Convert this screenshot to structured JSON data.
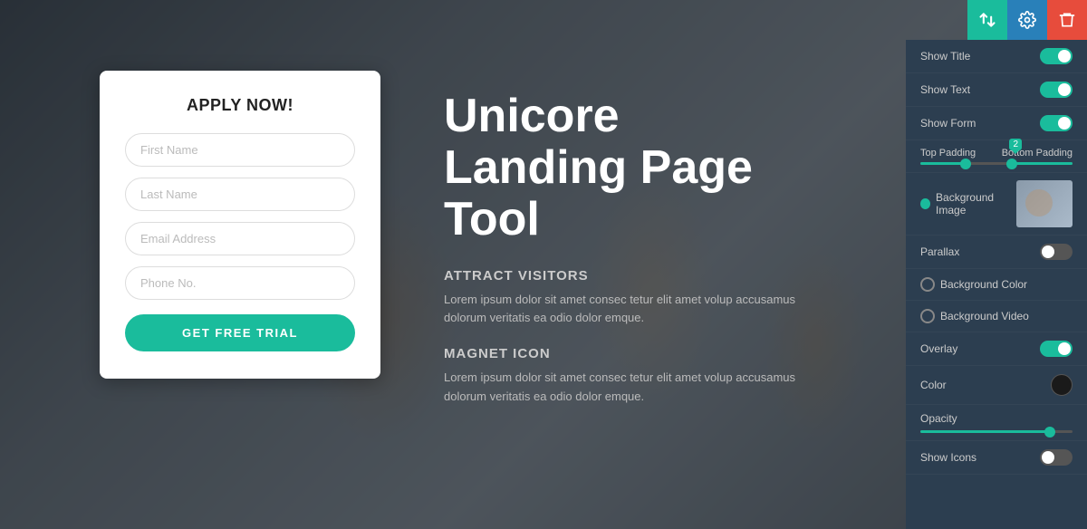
{
  "toolbar": {
    "transfer_title": "Transfer",
    "settings_title": "Settings",
    "delete_title": "Delete"
  },
  "form": {
    "title": "APPLY NOW!",
    "first_name_placeholder": "First Name",
    "last_name_placeholder": "Last Name",
    "email_placeholder": "Email Address",
    "phone_placeholder": "Phone No.",
    "submit_label": "GET FREE TRIAL"
  },
  "hero": {
    "title": "Unicore\nLanding Page Tool",
    "section1_title": "ATTRACT VISITORS",
    "section1_text": "Lorem ipsum dolor sit amet consec tetur elit amet volup accusamus dolorum veritatis ea odio dolor emque.",
    "section2_title": "MAGNET ICON",
    "section2_text": "Lorem ipsum dolor sit amet consec tetur elit amet volup accusamus dolorum veritatis ea odio dolor emque."
  },
  "panel": {
    "show_title_label": "Show Title",
    "show_text_label": "Show Text",
    "show_form_label": "Show Form",
    "top_padding_label": "Top Padding",
    "bottom_padding_label": "Bottom Padding",
    "slider_badge_value": "2",
    "background_image_label": "Background Image",
    "parallax_label": "Parallax",
    "background_color_label": "Background Color",
    "background_video_label": "Background Video",
    "overlay_label": "Overlay",
    "color_label": "Color",
    "opacity_label": "Opacity",
    "show_icons_label": "Show Icons"
  }
}
